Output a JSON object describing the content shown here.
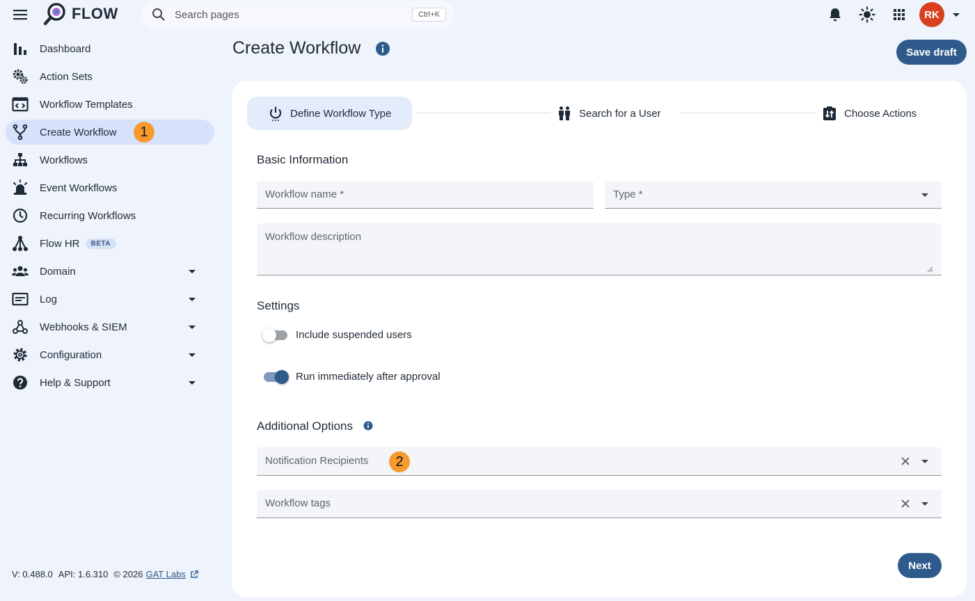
{
  "app": {
    "name": "FLOW"
  },
  "search": {
    "placeholder": "Search pages",
    "shortcut": "Ctrl+K"
  },
  "user": {
    "initials": "RK"
  },
  "sidebar": {
    "items": [
      {
        "label": "Dashboard"
      },
      {
        "label": "Action Sets"
      },
      {
        "label": "Workflow Templates"
      },
      {
        "label": "Create Workflow",
        "active": true,
        "badge": "1"
      },
      {
        "label": "Workflows"
      },
      {
        "label": "Event Workflows"
      },
      {
        "label": "Recurring Workflows"
      },
      {
        "label": "Flow HR",
        "tag": "BETA"
      },
      {
        "label": "Domain"
      },
      {
        "label": "Log"
      },
      {
        "label": "Webhooks & SIEM"
      },
      {
        "label": "Configuration"
      },
      {
        "label": "Help & Support"
      }
    ]
  },
  "footer": {
    "version": "V: 0.488.0",
    "api": "API: 1.6.310",
    "copyright": "© 2026",
    "company": "GAT Labs"
  },
  "header": {
    "title": "Create Workflow",
    "save_draft": "Save draft"
  },
  "stepper": {
    "steps": [
      "Define Workflow Type",
      "Search for a User",
      "Choose Actions"
    ]
  },
  "form": {
    "basic_title": "Basic Information",
    "name_label": "Workflow name *",
    "type_label": "Type *",
    "description_label": "Workflow description",
    "settings_title": "Settings",
    "toggle_suspended": "Include suspended users",
    "toggle_immediate": "Run immediately after approval",
    "additional_title": "Additional Options",
    "recipients_label": "Notification Recipients",
    "recipients_badge": "2",
    "tags_label": "Workflow tags",
    "next": "Next"
  },
  "colors": {
    "primary": "#2e5b8c",
    "avatar": "#d9411e",
    "badge": "#f79a2f",
    "active_nav": "#d6e2fb"
  }
}
